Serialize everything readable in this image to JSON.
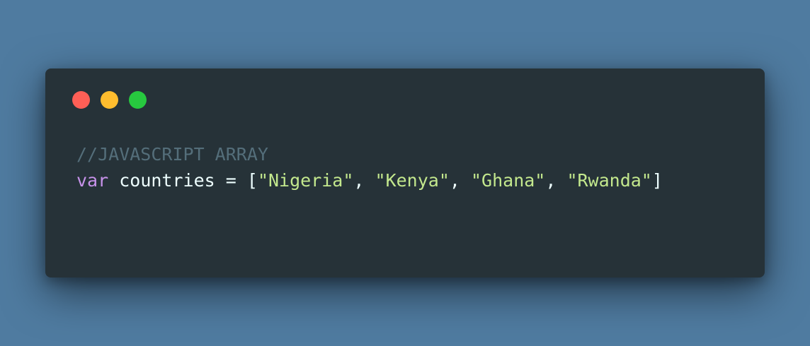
{
  "window": {
    "controls": [
      {
        "name": "close",
        "color": "#ff5f56"
      },
      {
        "name": "minimize",
        "color": "#ffbd2e"
      },
      {
        "name": "maximize",
        "color": "#27c93f"
      }
    ]
  },
  "code": {
    "language": "javascript",
    "comment": "//JAVASCRIPT ARRAY",
    "keyword": "var",
    "identifier": "countries",
    "operator": "=",
    "open_bracket": "[",
    "close_bracket": "]",
    "separator": ", ",
    "strings": [
      "\"Nigeria\"",
      "\"Kenya\"",
      "\"Ghana\"",
      "\"Rwanda\""
    ]
  },
  "colors": {
    "background": "#4f7ba0",
    "window": "#263238",
    "comment": "#546e7a",
    "keyword": "#c792ea",
    "string": "#c3e88d",
    "text": "#eeffff"
  }
}
